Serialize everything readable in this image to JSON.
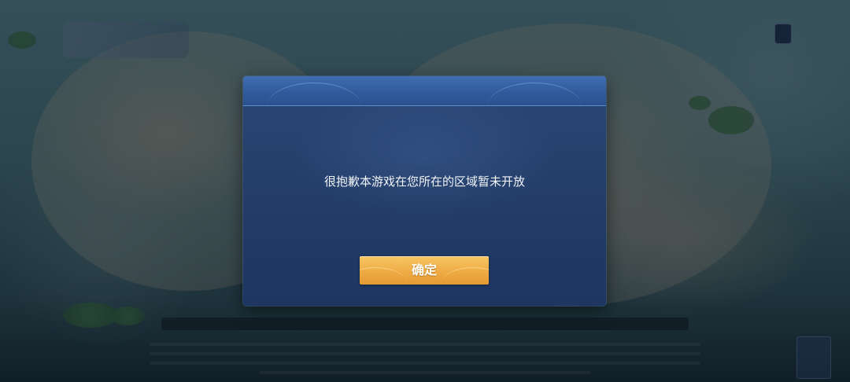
{
  "dialog": {
    "message": "很抱歉本游戏在您所在的区域暂未开放",
    "confirm_label": "确定"
  },
  "colors": {
    "dialog_background": "#233d68",
    "dialog_header": "#2f5a9a",
    "confirm_button": "#eeab44",
    "message_text": "#f2f4f8"
  },
  "background": {
    "description_icon_names": [
      "game-logo-icon",
      "age-rating-icon",
      "corner-badge-icon"
    ]
  }
}
